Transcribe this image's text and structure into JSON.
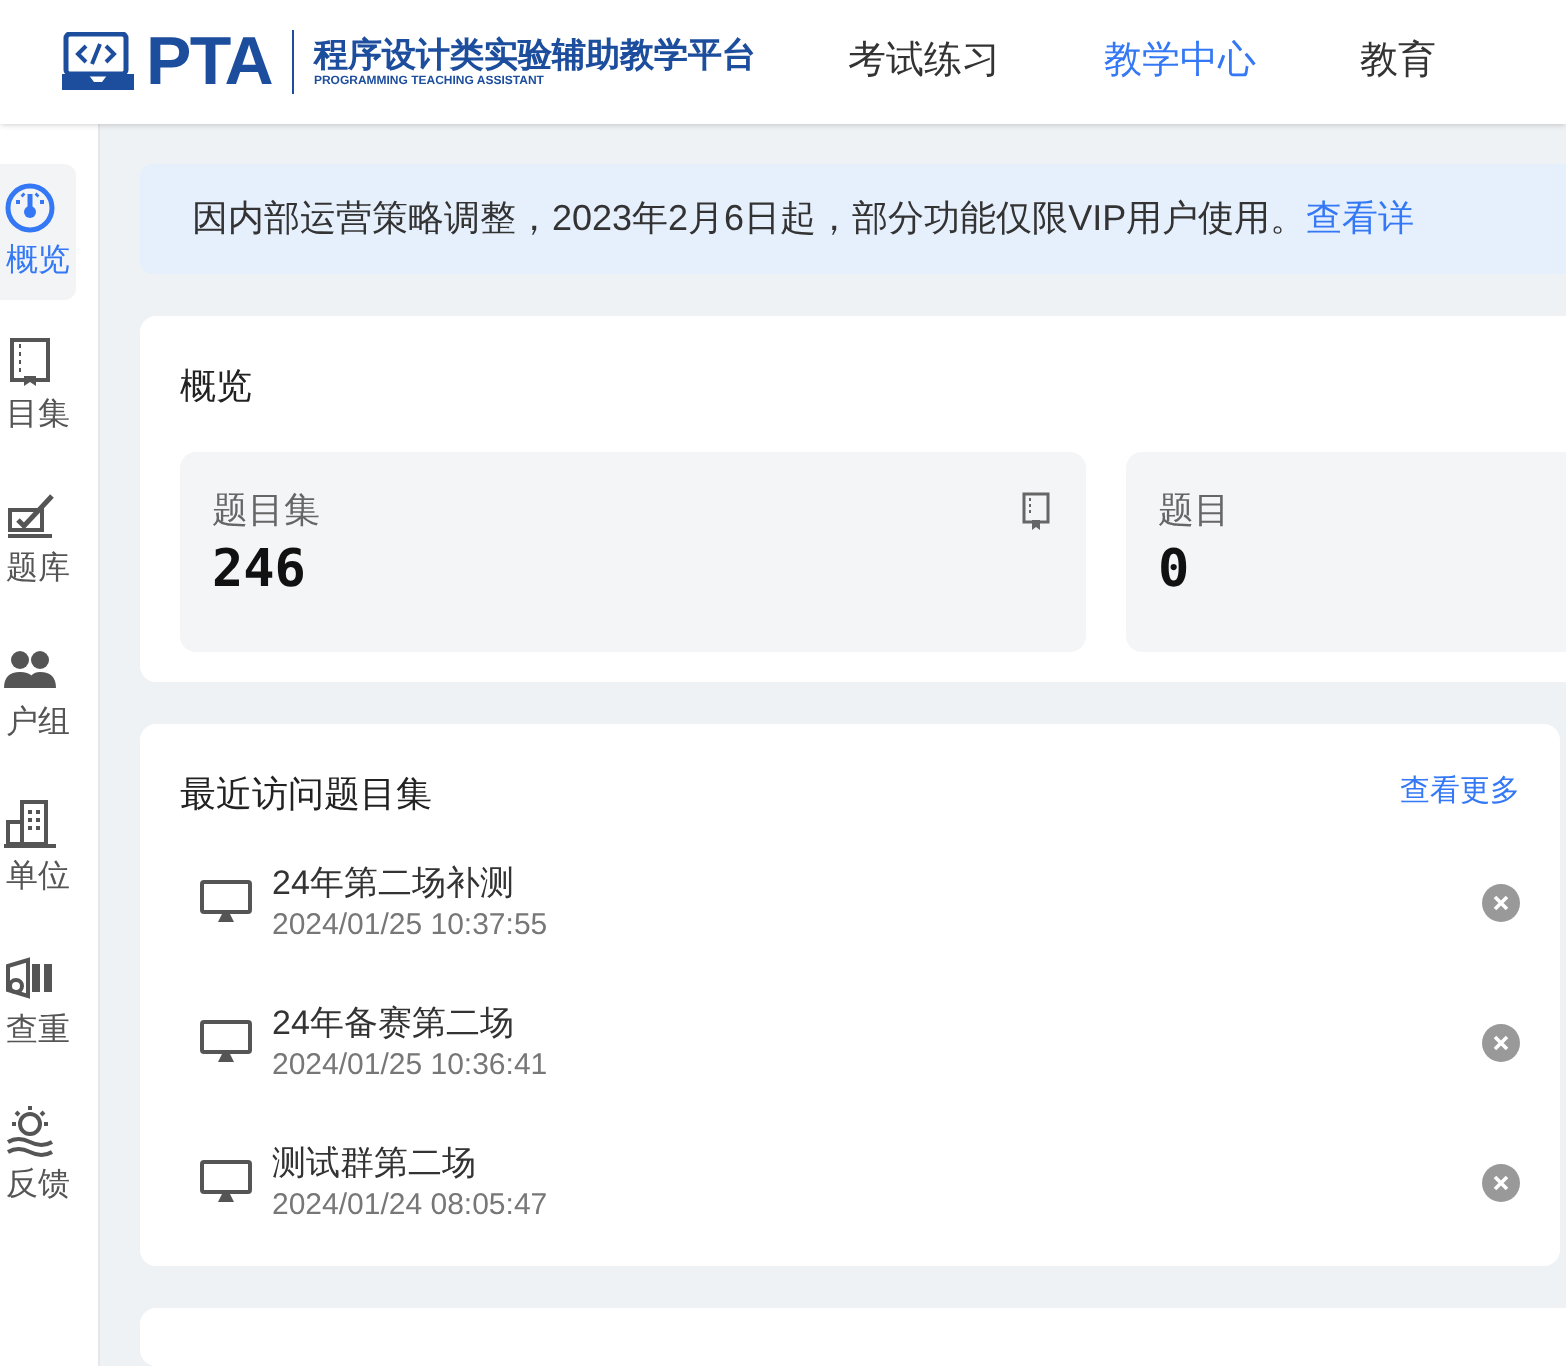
{
  "header": {
    "logo_text": "PTA",
    "logo_title": "程序设计类实验辅助教学平台",
    "logo_subtitle": "PROGRAMMING TEACHING ASSISTANT",
    "nav": [
      {
        "label": "考试练习",
        "selected": false
      },
      {
        "label": "教学中心",
        "selected": true
      },
      {
        "label": "教育",
        "selected": false
      }
    ]
  },
  "sidebar": {
    "items": [
      {
        "label": "概览",
        "kind": "gauge",
        "selected": true
      },
      {
        "label": "目集",
        "kind": "book",
        "selected": false
      },
      {
        "label": "题库",
        "kind": "pen",
        "selected": false
      },
      {
        "label": "户组",
        "kind": "users",
        "selected": false
      },
      {
        "label": "单位",
        "kind": "building",
        "selected": false
      },
      {
        "label": "查重",
        "kind": "compare",
        "selected": false
      },
      {
        "label": "反馈",
        "kind": "bulb",
        "selected": false
      }
    ]
  },
  "notice": {
    "text": "因内部运营策略调整，2023年2月6日起，部分功能仅限VIP用户使用。",
    "link": "查看详"
  },
  "overview": {
    "title": "概览",
    "stats": [
      {
        "label": "题目集",
        "value": "246",
        "icon": true
      },
      {
        "label": "题目",
        "value": "0",
        "icon": false
      }
    ]
  },
  "recent": {
    "title": "最近访问题目集",
    "more": "查看更多",
    "items": [
      {
        "name": "24年第二场补测",
        "time": "2024/01/25 10:37:55"
      },
      {
        "name": "24年备赛第二场",
        "time": "2024/01/25 10:36:41"
      },
      {
        "name": "测试群第二场",
        "time": "2024/01/24 08:05:47"
      }
    ]
  }
}
